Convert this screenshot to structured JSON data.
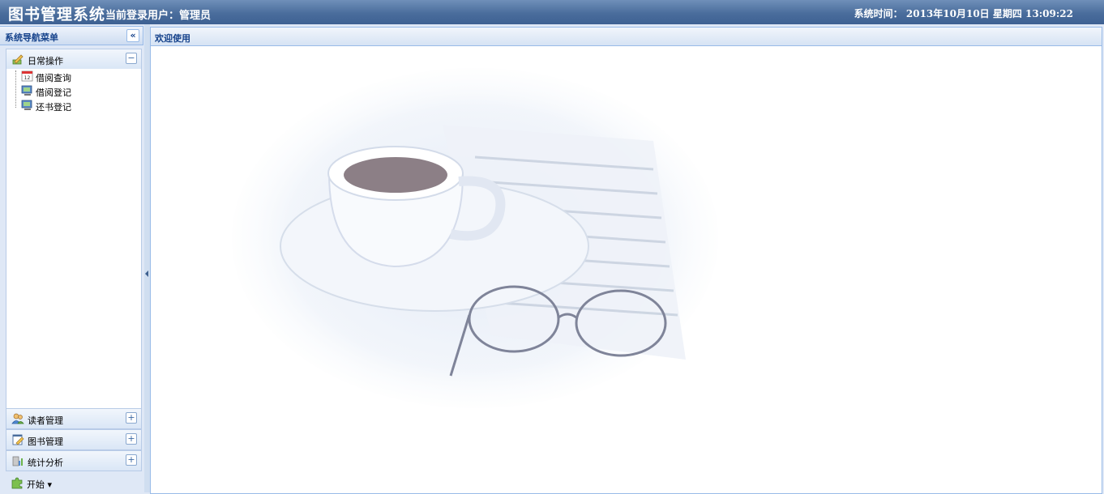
{
  "header": {
    "app_title": "图书管理系统",
    "user_label": "当前登录用户：管理员",
    "clock_label": "系统时间：",
    "clock_value": "2013年10月10日 星期四 13:09:22"
  },
  "nav": {
    "title": "系统导航菜单",
    "collapse_icon": "«",
    "sections": [
      {
        "label": "日常操作",
        "toggle": "−",
        "icon": "pencil-icon",
        "expanded": true,
        "items": [
          {
            "label": "借阅查询",
            "icon": "calendar-icon"
          },
          {
            "label": "借阅登记",
            "icon": "monitor-icon"
          },
          {
            "label": "还书登记",
            "icon": "monitor-icon"
          }
        ]
      },
      {
        "label": "读者管理",
        "toggle": "+",
        "icon": "users-icon"
      },
      {
        "label": "图书管理",
        "toggle": "+",
        "icon": "book-edit-icon"
      },
      {
        "label": "统计分析",
        "toggle": "+",
        "icon": "chart-icon"
      }
    ],
    "start_button": "开始 ▾"
  },
  "main": {
    "tab_title": "欢迎使用"
  },
  "colors": {
    "header": "#4a6d9c",
    "panel_border": "#99bbe8",
    "title_text": "#15428b"
  }
}
